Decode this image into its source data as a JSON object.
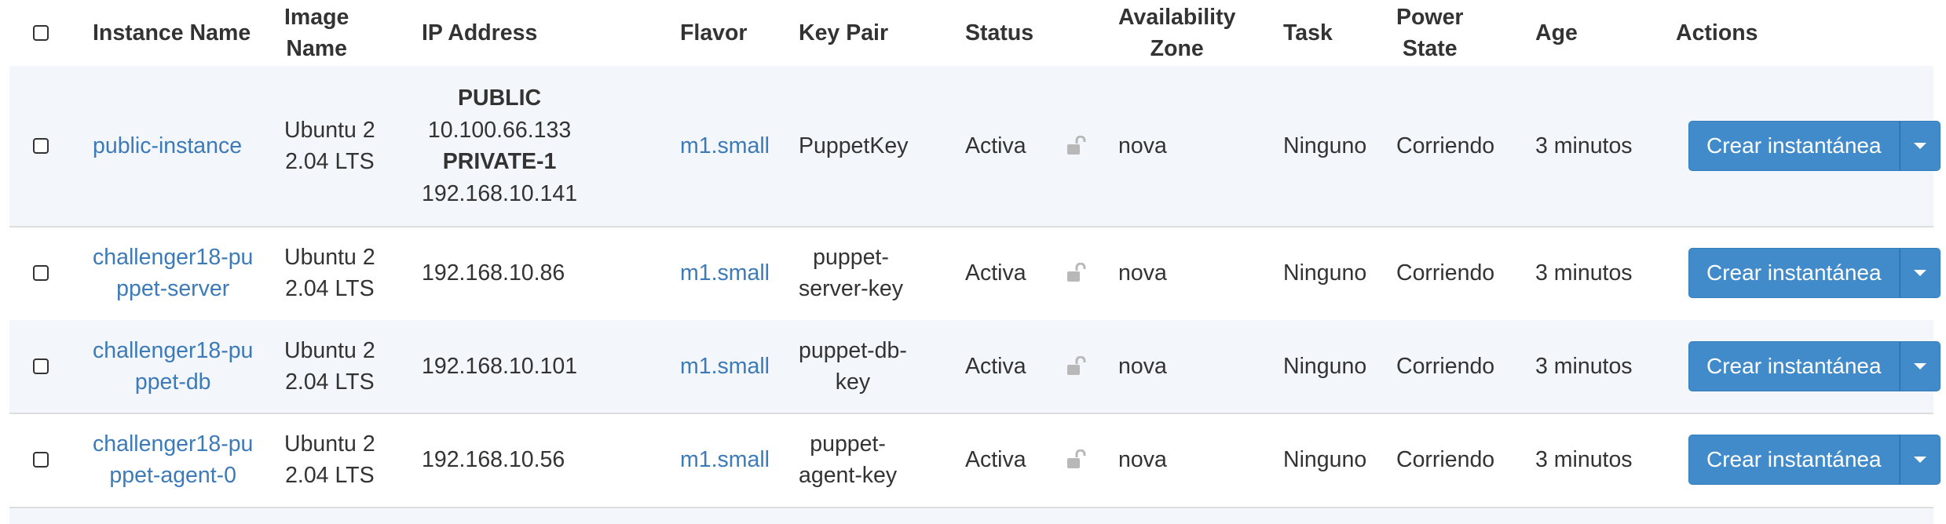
{
  "header": {
    "instance_name": "Instance Name",
    "image_name": [
      "Image",
      "Name"
    ],
    "ip_address": "IP Address",
    "flavor": "Flavor",
    "key_pair": "Key Pair",
    "status": "Status",
    "availability_zone": [
      "Availability",
      "Zone"
    ],
    "task": "Task",
    "power_state": [
      "Power",
      "State"
    ],
    "age": "Age",
    "actions": "Actions"
  },
  "rows": [
    {
      "name": [
        "public-instance"
      ],
      "image": [
        "Ubuntu 2",
        "2.04 LTS"
      ],
      "ip": [
        {
          "text": "PUBLIC",
          "label": true
        },
        {
          "text": "10.100.66.133",
          "label": false
        },
        {
          "text": "PRIVATE-1",
          "label": true
        },
        {
          "text": "192.168.10.141",
          "label": false
        }
      ],
      "flavor": "m1.small",
      "key_pair": [
        "PuppetKey"
      ],
      "status": "Activa",
      "zone": "nova",
      "task": "Ninguno",
      "power": "Corriendo",
      "age": "3 minutos",
      "action": "Crear instantánea"
    },
    {
      "name": [
        "challenger18-pu",
        "ppet-server"
      ],
      "image": [
        "Ubuntu 2",
        "2.04 LTS"
      ],
      "ip": [
        {
          "text": "192.168.10.86",
          "label": false
        }
      ],
      "flavor": "m1.small",
      "key_pair": [
        "puppet-",
        "server-key"
      ],
      "status": "Activa",
      "zone": "nova",
      "task": "Ninguno",
      "power": "Corriendo",
      "age": "3 minutos",
      "action": "Crear instantánea"
    },
    {
      "name": [
        "challenger18-pu",
        "ppet-db"
      ],
      "image": [
        "Ubuntu 2",
        "2.04 LTS"
      ],
      "ip": [
        {
          "text": "192.168.10.101",
          "label": false
        }
      ],
      "flavor": "m1.small",
      "key_pair": [
        "puppet-db-",
        "key"
      ],
      "status": "Activa",
      "zone": "nova",
      "task": "Ninguno",
      "power": "Corriendo",
      "age": "3 minutos",
      "action": "Crear instantánea"
    },
    {
      "name": [
        "challenger18-pu",
        "ppet-agent-0"
      ],
      "image": [
        "Ubuntu 2",
        "2.04 LTS"
      ],
      "ip": [
        {
          "text": "192.168.10.56",
          "label": false
        }
      ],
      "flavor": "m1.small",
      "key_pair": [
        "puppet-",
        "agent-key"
      ],
      "status": "Activa",
      "zone": "nova",
      "task": "Ninguno",
      "power": "Corriendo",
      "age": "3 minutos",
      "action": "Crear instantánea"
    }
  ],
  "icons": {
    "lock": "unlock-icon",
    "caret": "caret-down-icon"
  },
  "colors": {
    "link": "#3d7ab8",
    "button": "#428bca",
    "stripe": "#f3f6fa"
  }
}
